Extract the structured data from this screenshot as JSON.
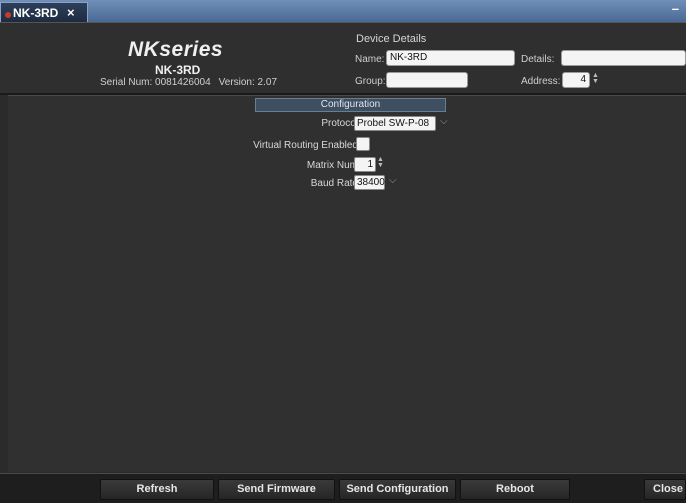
{
  "tab": {
    "label": "NK-3RD",
    "close": "×",
    "minimize": "–"
  },
  "header": {
    "brand": "NKseries",
    "model": "NK-3RD",
    "serial_label": "Serial Num: 0081426004",
    "version_label": "Version: 2.07"
  },
  "device_details": {
    "title": "Device Details",
    "name_label": "Name:",
    "name_value": "NK-3RD",
    "details_label": "Details:",
    "details_value": "",
    "group_label": "Group:",
    "group_value": "",
    "address_label": "Address:",
    "address_value": "4"
  },
  "configuration": {
    "title": "Configuration",
    "protocol_label": "Protocol",
    "protocol_value": "Probel SW-P-08",
    "virtual_routing_label": "Virtual Routing Enabled",
    "virtual_routing_checked": false,
    "matrix_num_label": "Matrix Num",
    "matrix_num_value": "1",
    "baud_rate_label": "Baud Rate",
    "baud_rate_value": "38400"
  },
  "footer": {
    "refresh": "Refresh",
    "send_firmware": "Send Firmware",
    "send_configuration": "Send Configuration",
    "reboot": "Reboot",
    "close": "Close"
  }
}
